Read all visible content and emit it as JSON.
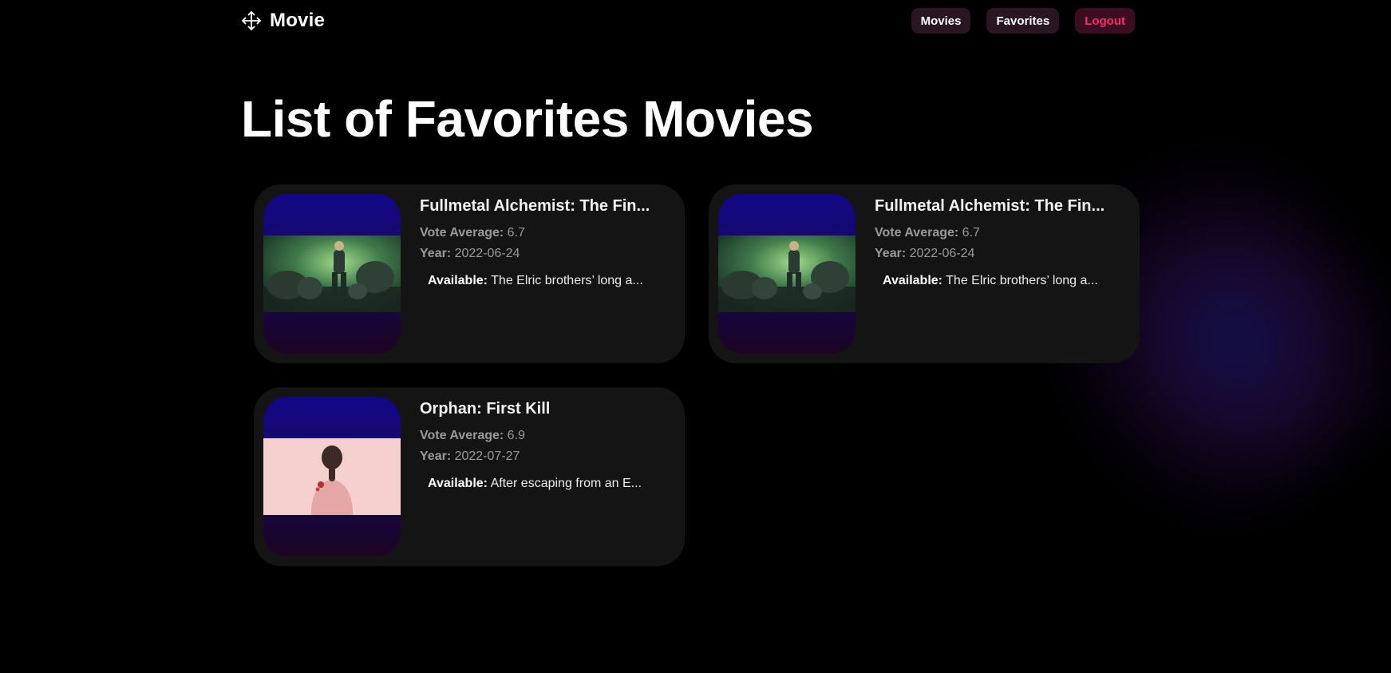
{
  "header": {
    "brand": "Movie",
    "brand_icon": "move-arrows-icon",
    "nav": {
      "movies": "Movies",
      "favorites": "Favorites",
      "logout": "Logout"
    }
  },
  "main": {
    "title": "List of Favorites Movies"
  },
  "labels": {
    "vote_average": "Vote Average:",
    "year": "Year:",
    "available": "Available:"
  },
  "movies": [
    {
      "title": "Fullmetal Alchemist: The Fin...",
      "vote_average": "6.7",
      "year": "2022-06-24",
      "available": "The Elric brothers’ long a..."
    },
    {
      "title": "Fullmetal Alchemist: The Fin...",
      "vote_average": "6.7",
      "year": "2022-06-24",
      "available": "The Elric brothers’ long a..."
    },
    {
      "title": "Orphan: First Kill",
      "vote_average": "6.9",
      "year": "2022-07-27",
      "available": "After escaping from an E..."
    }
  ],
  "colors": {
    "background": "#000000",
    "card": "#141414",
    "nav_button": "#2a1523",
    "logout_text": "#ff2a6a"
  }
}
